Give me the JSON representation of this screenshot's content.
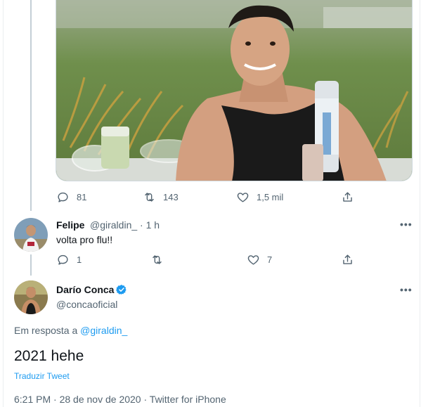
{
  "original_tweet": {
    "photo_alt": "",
    "reply_count": "81",
    "retweet_count": "143",
    "like_count": "1,5 mil"
  },
  "reply_felipe": {
    "display_name": "Felipe",
    "handle": "@giraldin_",
    "separator": "·",
    "time": "1 h",
    "text": "volta pro flu!!",
    "reply_count": "1",
    "retweet_count": "",
    "like_count": "7"
  },
  "main_tweet": {
    "display_name": "Darío Conca",
    "handle": "@concaoficial",
    "verified": true,
    "reply_to_prefix": "Em resposta a",
    "reply_to_handle": "@giraldin_",
    "text": "2021 hehe",
    "translate_label": "Traduzir Tweet",
    "time": "6:21 PM",
    "date": "28 de nov de 2020",
    "source": "Twitter for iPhone",
    "meta_separator": "·"
  },
  "icons": {
    "reply": "reply-icon",
    "retweet": "retweet-icon",
    "like": "heart-icon",
    "share": "share-icon",
    "more": "more-icon",
    "verified": "verified-badge-icon"
  },
  "colors": {
    "accent": "#1d9bf0",
    "secondary_text": "#536471",
    "primary_text": "#0f1419",
    "thread_line": "#c4cfd6"
  }
}
